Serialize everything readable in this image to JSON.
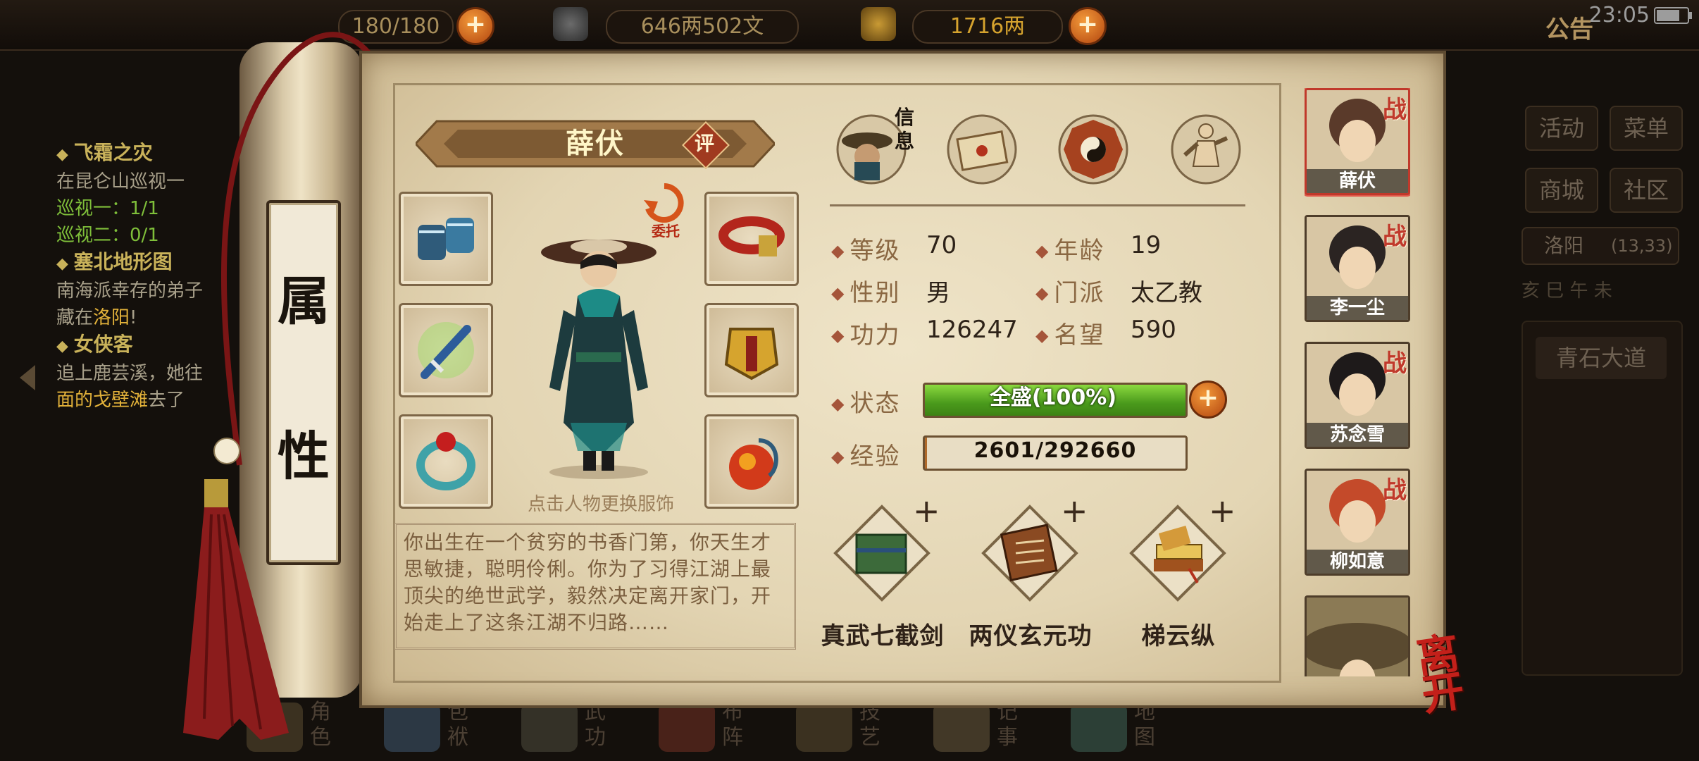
{
  "hud": {
    "stamina": "180/180",
    "money": "646两502文",
    "gold": "1716两",
    "notice": "公告",
    "time": "23:05",
    "battery_level": 0.8
  },
  "quest_log": {
    "q1_title": "飞霜之灾",
    "q1_desc": "在昆仑山巡视一",
    "q1_prog1": "巡视一：1/1",
    "q1_prog2": "巡视二：0/1",
    "q2_title": "塞北地形图",
    "q2_desc1": "南海派幸存的弟子",
    "q2_desc2_a": "藏在",
    "q2_desc2_place": "洛阳",
    "q2_desc2_b": "!",
    "q3_title": "女侠客",
    "q3_desc1": "追上鹿芸溪，她往",
    "q3_desc2_place": "面的戈壁滩",
    "q3_desc2_b": "去了"
  },
  "scroll": {
    "char1": "属",
    "char2": "性"
  },
  "character": {
    "name": "薛伏",
    "review": "评",
    "entrust": "委托",
    "change_outfit": "点击人物更换服饰",
    "bio": "你出生在一个贫穷的书香门第，你天生才思敏捷，聪明伶俐。你为了习得江湖上最顶尖的绝世武学，毅然决定离开家门，开始走上了这条江湖不归路……"
  },
  "tabs": {
    "info": "信息"
  },
  "stats": {
    "level_label": "等级",
    "level": "70",
    "age_label": "年龄",
    "age": "19",
    "gender_label": "性别",
    "gender": "男",
    "sect_label": "门派",
    "sect": "太乙教",
    "power_label": "功力",
    "power": "126247",
    "fame_label": "名望",
    "fame": "590",
    "status_label": "状态",
    "status": "全盛(100%)",
    "status_fraction": 1.0,
    "exp_label": "经验",
    "exp": "2601/292660",
    "exp_fraction": 0.0089
  },
  "skills": [
    {
      "name": "真武七截剑"
    },
    {
      "name": "两仪玄元功"
    },
    {
      "name": "梯云纵"
    }
  ],
  "skill_plus": "+",
  "party": [
    {
      "name": "薛伏",
      "badge": "战"
    },
    {
      "name": "李一尘",
      "badge": "战"
    },
    {
      "name": "苏念雪",
      "badge": "战"
    },
    {
      "name": "柳如意",
      "badge": "战"
    },
    {
      "name": "",
      "badge": ""
    }
  ],
  "side_menu": {
    "activity": "活动",
    "menu": "菜单",
    "shop": "商城",
    "community": "社区",
    "location": "洛阳",
    "coords": "(13,33)",
    "place": "青石大道"
  },
  "bottom_nav": [
    "角色",
    "包袱",
    "武功",
    "布阵",
    "技艺",
    "记事",
    "地图"
  ],
  "leave": "离开",
  "colors": {
    "accent_red": "#c0392b",
    "status_green": "#4a9a1c",
    "parchment": "#e3d5b3"
  }
}
